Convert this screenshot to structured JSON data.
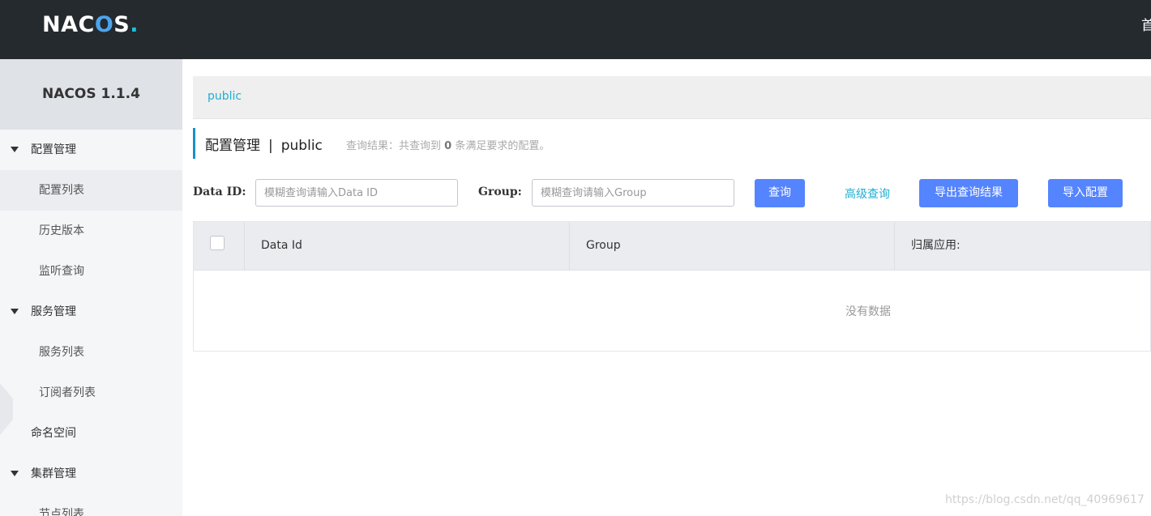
{
  "header": {
    "logo_text_a": "NA",
    "logo_text_b": "C",
    "logo_text_c": "O",
    "logo_text_d": "S",
    "logo_dot": ".",
    "right_nav_item": "首"
  },
  "sidebar": {
    "version_title": "NACOS 1.1.4",
    "groups": [
      {
        "label": "配置管理",
        "items": [
          "配置列表",
          "历史版本",
          "监听查询"
        ]
      },
      {
        "label": "服务管理",
        "items": [
          "服务列表",
          "订阅者列表"
        ]
      },
      {
        "label": "命名空间"
      },
      {
        "label": "集群管理",
        "items": [
          "节点列表"
        ]
      }
    ],
    "active_item": "配置列表"
  },
  "breadcrumb": {
    "namespace": "public"
  },
  "page": {
    "title": "配置管理",
    "separator": "|",
    "namespace": "public",
    "result_prefix": "查询结果：共查询到",
    "result_count": "0",
    "result_suffix": "条满足要求的配置。"
  },
  "search": {
    "data_id_label": "Data ID:",
    "data_id_placeholder": "模糊查询请输入Data ID",
    "group_label": "Group:",
    "group_placeholder": "模糊查询请输入Group",
    "query_button": "查询",
    "advanced_query": "高级查询",
    "export_button": "导出查询结果",
    "import_button": "导入配置"
  },
  "table": {
    "columns": [
      "Data Id",
      "Group",
      "归属应用:"
    ],
    "empty_text": "没有数据"
  },
  "watermark": "https://blog.csdn.net/qq_40969617",
  "colors": {
    "header_bg": "#252a2f",
    "primary_button": "#5584ff",
    "link": "#1faed2",
    "accent_bar": "#1990c9"
  }
}
